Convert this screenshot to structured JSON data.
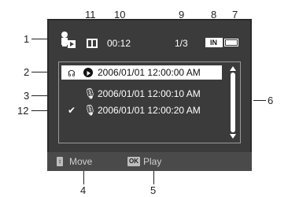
{
  "callouts": {
    "n1": "1",
    "n2": "2",
    "n3": "3",
    "n4": "4",
    "n5": "5",
    "n6": "6",
    "n7": "7",
    "n8": "8",
    "n9": "9",
    "n10": "10",
    "n11": "11",
    "n12": "12"
  },
  "screen": {
    "time": "00:12",
    "counter": "1/3",
    "memory_label": "IN",
    "rows": [
      {
        "label": "2006/01/01 12:00:00 AM",
        "selected": true
      },
      {
        "label": "2006/01/01 12:00:10 AM",
        "selected": false
      },
      {
        "label": "2006/01/01 12:00:20 AM",
        "selected": false
      }
    ],
    "buttons": {
      "move_badge": "↕",
      "move_label": "Move",
      "play_badge": "OK",
      "play_label": "Play"
    }
  }
}
